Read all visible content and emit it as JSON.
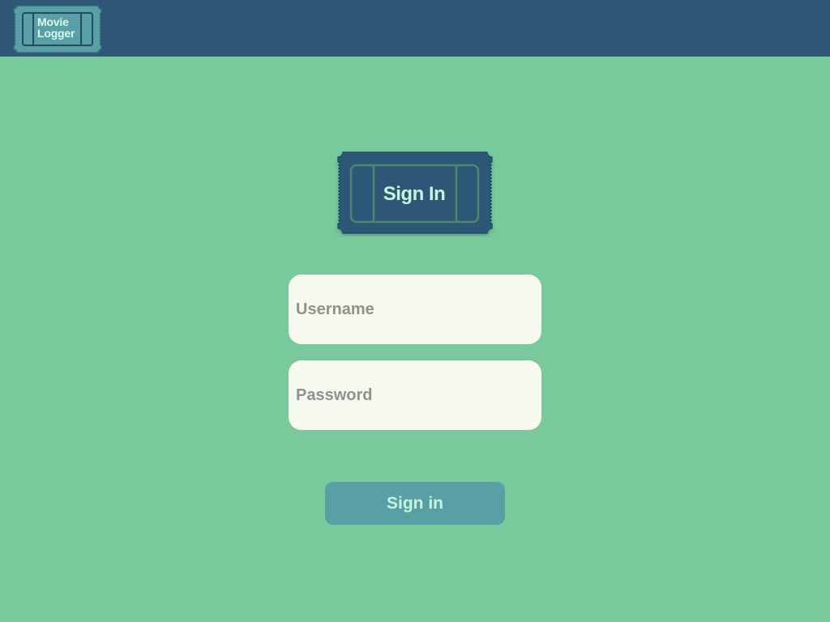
{
  "header": {
    "logo_line1": "Movie",
    "logo_line2": "Logger"
  },
  "hero": {
    "title": "Sign In"
  },
  "form": {
    "username_placeholder": "Username",
    "username_value": "",
    "password_placeholder": "Password",
    "password_value": "",
    "submit_label": "Sign in"
  },
  "colors": {
    "background": "#78c99c",
    "header": "#2e5677",
    "logo_ticket": "#58a0a6",
    "hero_ticket": "#2e5677",
    "input_background": "#f6faee",
    "button": "#58a0a6",
    "accent_text": "#c7f4dd"
  },
  "icons": {
    "logo": "ticket-icon",
    "hero": "ticket-icon"
  }
}
